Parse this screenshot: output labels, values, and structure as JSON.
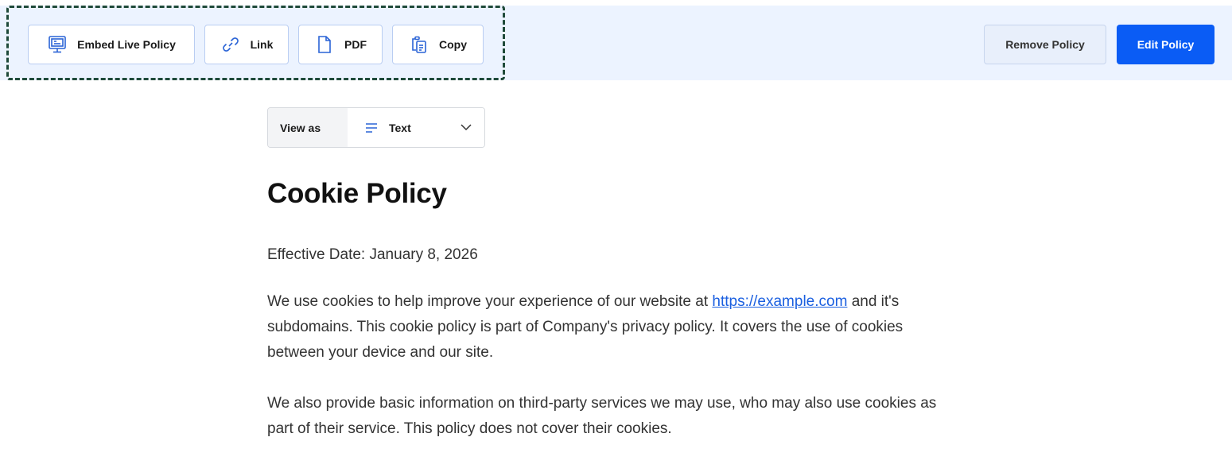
{
  "toolbar": {
    "embed_label": "Embed Live Policy",
    "link_label": "Link",
    "pdf_label": "PDF",
    "copy_label": "Copy",
    "remove_label": "Remove Policy",
    "edit_label": "Edit Policy",
    "icons": [
      "embed-monitor-icon",
      "link-icon",
      "pdf-document-icon",
      "copy-clipboard-icon"
    ]
  },
  "view_as": {
    "label": "View as",
    "selected": "Text",
    "icon": "text-lines-icon"
  },
  "policy": {
    "title": "Cookie Policy",
    "effective_date": "Effective Date: January 8, 2026",
    "para1_link": "https://example.com",
    "para1_pre": "We use cookies to help improve your experience of our website at ",
    "para1_post": " and it's subdomains. This cookie policy is part of Company's privacy policy. It covers the use of cookies between your device and our site.",
    "para2": "We also provide basic information on third-party services we may use, who may also use cookies as part of their service. This policy does not cover their cookies."
  },
  "colors": {
    "accent": "#0a5cf5",
    "toolbar_bg": "#ecf3ff",
    "highlight_border": "#1f4a3a",
    "link": "#1a5fe0"
  }
}
